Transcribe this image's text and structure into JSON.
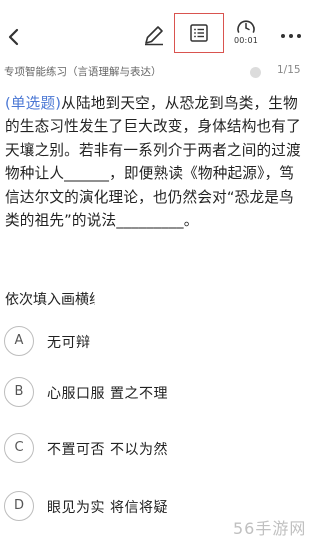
{
  "header": {
    "back_icon": "chevron-left-icon",
    "edit_icon": "pencil-icon",
    "list_icon": "answer-sheet-icon",
    "timer_icon": "clock-icon",
    "timer_value": "00:01",
    "more_icon": "more-dots-icon",
    "highlight_color": "#d9534f"
  },
  "info": {
    "breadcrumb": "专项智能练习（言语理解与表达）",
    "pager": "1/15"
  },
  "question": {
    "type_tag": "(单选题)",
    "text": "从陆地到天空，从恐龙到鸟类，生物的生态习性发生了巨大改变，身体结构也有了天壤之别。若非有一系列介于两者之间的过渡物种让人______，即便熟读《物种起源》，笃信达尔文的演化理论，也仍然会对“恐龙是鸟类的祖先”的说法_________。",
    "instruction": "依次填入画横线部分最恰当的一项是",
    "tag_color": "#4a77d4"
  },
  "options": [
    {
      "letter": "A",
      "text": "无可辩驳 不以为然"
    },
    {
      "letter": "B",
      "text": "心服口服 置之不理"
    },
    {
      "letter": "C",
      "text": "不置可否 不以为然"
    },
    {
      "letter": "D",
      "text": "眼见为实 将信将疑"
    }
  ],
  "watermark": "56手游网"
}
